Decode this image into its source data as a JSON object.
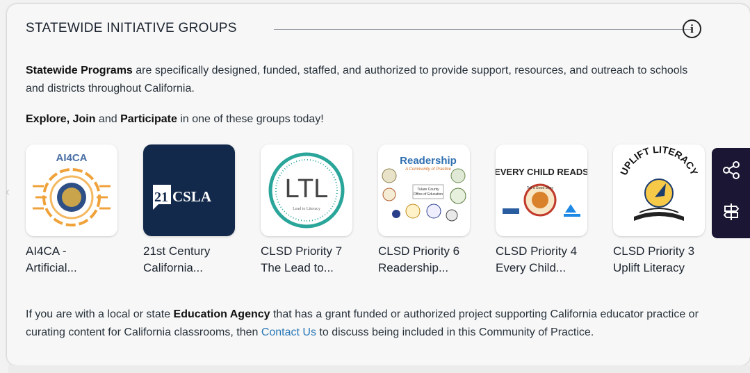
{
  "header": {
    "title": "STATEWIDE INITIATIVE GROUPS",
    "info_icon": "i"
  },
  "intro": {
    "bold": "Statewide Programs",
    "rest": " are specifically designed, funded, staffed, and authorized to provide support, resources, and outreach to schools and districts throughout California."
  },
  "explore": {
    "b1": "Explore, Join",
    "t1": " and ",
    "b2": "Participate",
    "t2": " in one of these groups today!"
  },
  "groups": [
    {
      "line1": "AI4CA -",
      "line2": "Artificial...",
      "logo_text": "AI4CA",
      "icon": "circuit-seal-logo"
    },
    {
      "line1": "21st Century",
      "line2": "California...",
      "logo_text": "21CSLA",
      "icon": "21csla-logo"
    },
    {
      "line1": "CLSD Priority 7",
      "line2": "The Lead to...",
      "logo_text": "LTL",
      "logo_sub": "Lead to Literacy",
      "icon": "ltl-logo"
    },
    {
      "line1": "CLSD Priority 6",
      "line2": "Readership...",
      "logo_text": "Readership",
      "logo_sub": "A Community of Practice",
      "icon": "readership-logo"
    },
    {
      "line1": "CLSD Priority 4",
      "line2": "Every Child...",
      "logo_text": "EVERY CHILD READS",
      "logo_sub": "Tell a Good Story",
      "icon": "every-child-reads-logo"
    },
    {
      "line1": "CLSD Priority 3",
      "line2": "Uplift Literacy",
      "logo_text": "UPLIFT LITERACY",
      "icon": "uplift-literacy-logo"
    }
  ],
  "footer": {
    "t1": "If you are with a local or state ",
    "b1": "Education Agency",
    "t2": " that has a grant funded or authorized project supporting California educator practice or curating content for California classrooms, then ",
    "link": "Contact Us",
    "t3": " to discuss being included in this Community of Practice."
  },
  "side": {
    "share_icon": "share-icon",
    "signpost_icon": "signpost-icon"
  },
  "colors": {
    "side_tab": "#1a1633",
    "link": "#2a78b6",
    "csla_bg": "#13294b",
    "ltl_teal": "#2aa59a"
  }
}
